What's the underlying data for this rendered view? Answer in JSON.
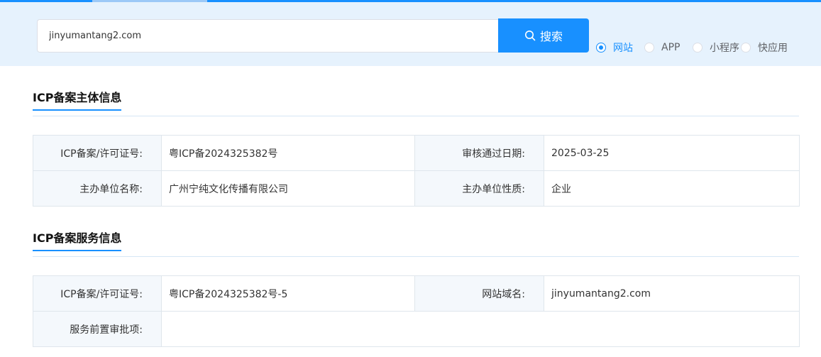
{
  "search": {
    "value": "jinyumantang2.com",
    "button_label": "搜索"
  },
  "types": [
    {
      "label": "网站",
      "checked": true
    },
    {
      "label": "APP",
      "checked": false
    },
    {
      "label": "小程序",
      "checked": false
    },
    {
      "label": "快应用",
      "checked": false
    }
  ],
  "subject_section": {
    "title": "ICP备案主体信息",
    "rows": [
      {
        "label1": "ICP备案/许可证号:",
        "value1": "粤ICP备2024325382号",
        "label2": "审核通过日期:",
        "value2": "2025-03-25"
      },
      {
        "label1": "主办单位名称:",
        "value1": "广州宁纯文化传播有限公司",
        "label2": "主办单位性质:",
        "value2": "企业"
      }
    ]
  },
  "service_section": {
    "title": "ICP备案服务信息",
    "rows": [
      {
        "label1": "ICP备案/许可证号:",
        "value1": "粤ICP备2024325382号-5",
        "label2": "网站域名:",
        "value2": "jinyumantang2.com"
      },
      {
        "label1": "服务前置审批项:",
        "value1": ""
      }
    ]
  },
  "colors": {
    "accent": "#1890ff",
    "band": "#e6f2fd",
    "label_bg": "#f4f8fc"
  }
}
